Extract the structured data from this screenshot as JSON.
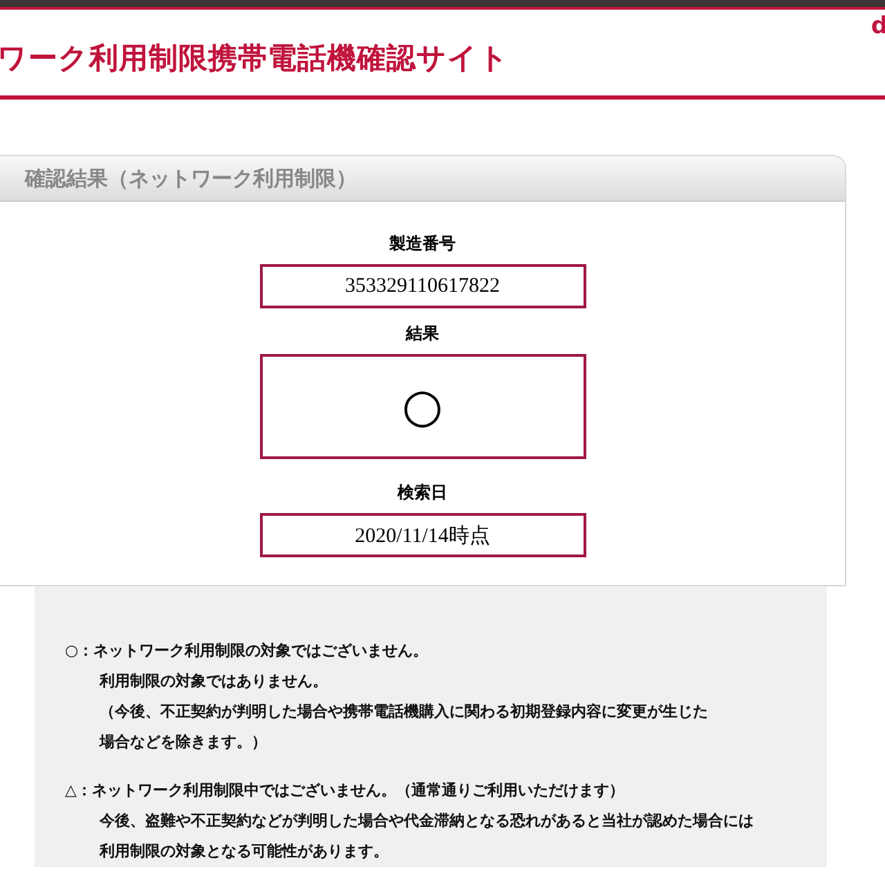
{
  "header": {
    "title": "ワーク利用制限携帯電話機確認サイト",
    "logo": "d"
  },
  "panel": {
    "title": "確認結果（ネットワーク利用制限）",
    "fields": [
      {
        "kind": "text",
        "label": "製造番号",
        "value": "353329110617822"
      },
      {
        "kind": "symbol",
        "label": "結果",
        "value": "○"
      },
      {
        "kind": "text",
        "label": "検索日",
        "value": "2020/11/14時点"
      }
    ]
  },
  "notes": [
    {
      "heading": "○：ネットワーク利用制限の対象ではございません。",
      "lines": [
        "利用制限の対象ではありません。",
        "（今後、不正契約が判明した場合や携帯電話機購入に関わる初期登録内容に変更が生じた",
        "場合などを除きます。）"
      ]
    },
    {
      "heading": "△：ネットワーク利用制限中ではございません。（通常通りご利用いただけます）",
      "lines": [
        "今後、盗難や不正契約などが判明した場合や代金滞納となる恐れがあると当社が認めた場合には",
        "利用制限の対象となる可能性があります。"
      ]
    }
  ]
}
